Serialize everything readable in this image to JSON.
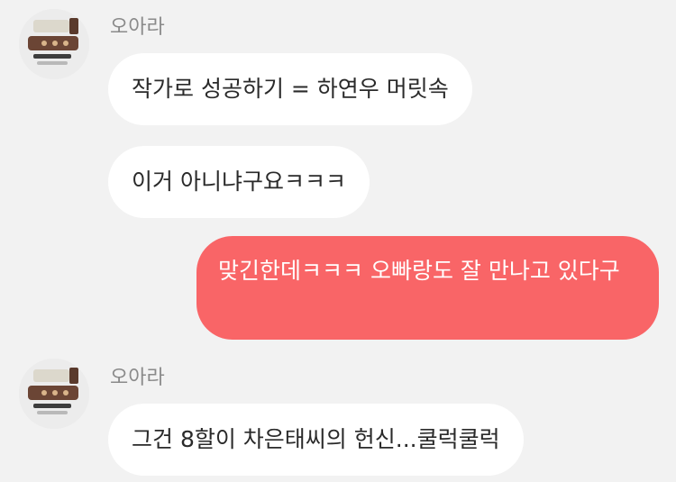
{
  "conversation": [
    {
      "sender": "오아라",
      "avatar_icon": "product-photo-avatar-icon",
      "messages": [
        "작가로 성공하기 = 하연우 머릿속",
        "이거 아니냐구요ㅋㅋㅋ"
      ]
    },
    {
      "sender": "me",
      "messages": [
        "맞긴한데ㅋㅋㅋ 오빠랑도 잘 만나고 있다구"
      ]
    },
    {
      "sender": "오아라",
      "avatar_icon": "product-photo-avatar-icon",
      "messages": [
        "그건 8할이 차은태씨의 헌신...쿨럭쿨럭"
      ]
    }
  ],
  "colors": {
    "background": "#f2f2f2",
    "incoming_bubble": "#ffffff",
    "outgoing_bubble": "#f96567",
    "sender_name": "#8a8a8a"
  }
}
